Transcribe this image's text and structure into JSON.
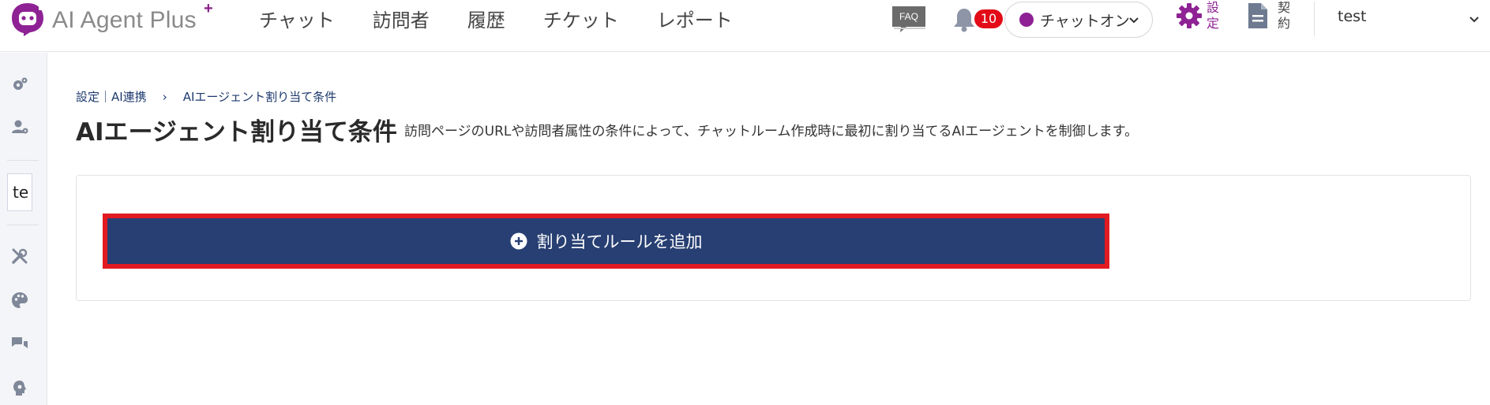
{
  "app": {
    "logo_text": "AI Agent Plus",
    "logo_plus": "+",
    "brand_color": "#8e2294"
  },
  "nav": {
    "items": [
      {
        "label": "チャット"
      },
      {
        "label": "訪問者"
      },
      {
        "label": "履歴"
      },
      {
        "label": "チケット"
      },
      {
        "label": "レポート"
      }
    ]
  },
  "header": {
    "faq_label": "FAQ",
    "notification_count": "10",
    "status_label": "チャットオン",
    "settings_label": "設定",
    "contract_label": "契約",
    "user_name": "test"
  },
  "sidebar": {
    "input_value": "te",
    "icons": [
      "gear-cog-icon",
      "user-gear-icon",
      "tools-icon",
      "palette-icon",
      "chat-bubbles-icon",
      "ai-head-icon"
    ]
  },
  "breadcrumb": {
    "root": "設定｜AI連携",
    "separator": "›",
    "current": "AIエージェント割り当て条件"
  },
  "page": {
    "title": "AIエージェント割り当て条件",
    "description": "訪問ページのURLや訪問者属性の条件によって、チャットルーム作成時に最初に割り当てるAIエージェントを制御します。"
  },
  "actions": {
    "add_rule_label": "割り当てルールを追加",
    "button_color": "#273f72",
    "highlight_color": "#e21a22"
  }
}
